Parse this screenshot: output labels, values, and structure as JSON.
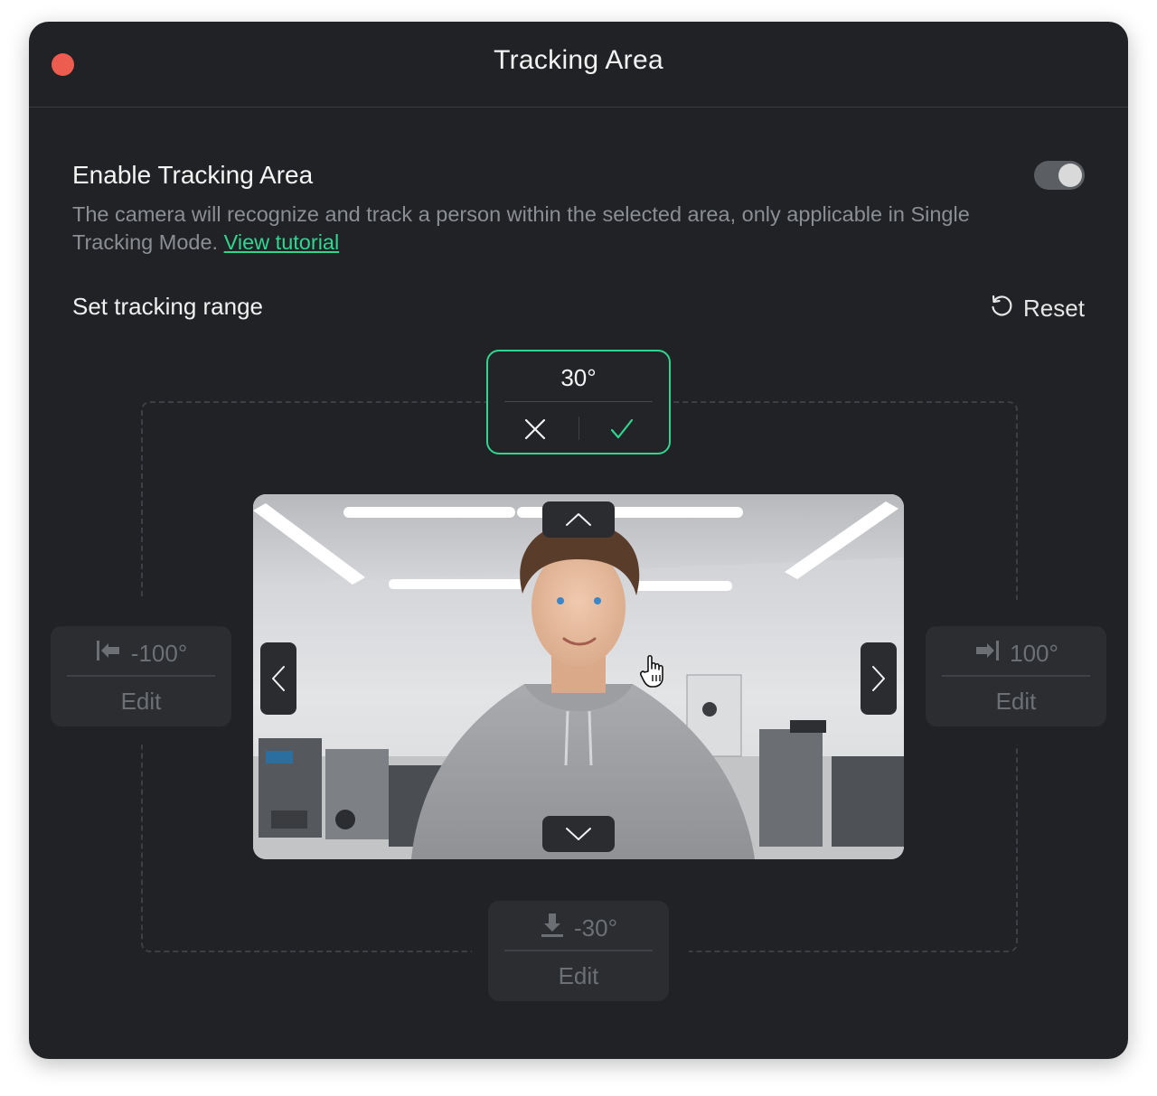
{
  "window": {
    "title": "Tracking Area"
  },
  "enable": {
    "label": "Enable Tracking Area",
    "enabled": true,
    "description": "The camera will recognize and track a person within the selected area, only applicable in Single Tracking Mode.",
    "tutorial_link": "View tutorial"
  },
  "range": {
    "label": "Set tracking range",
    "reset_label": "Reset",
    "top": {
      "value": "30°"
    },
    "left": {
      "value": "-100°",
      "edit_label": "Edit"
    },
    "right": {
      "value": "100°",
      "edit_label": "Edit"
    },
    "bottom": {
      "value": "-30°",
      "edit_label": "Edit"
    }
  },
  "colors": {
    "accent": "#2fd68f",
    "window_bg": "#202225",
    "close": "#ec5d4f"
  },
  "icons": {
    "close": "close-dot",
    "reset": "rotate-ccw-icon",
    "cancel": "x-icon",
    "confirm": "check-icon",
    "left_limit": "arrow-to-left-limit-icon",
    "right_limit": "arrow-to-right-limit-icon",
    "bottom_limit": "arrow-down-limit-icon"
  }
}
